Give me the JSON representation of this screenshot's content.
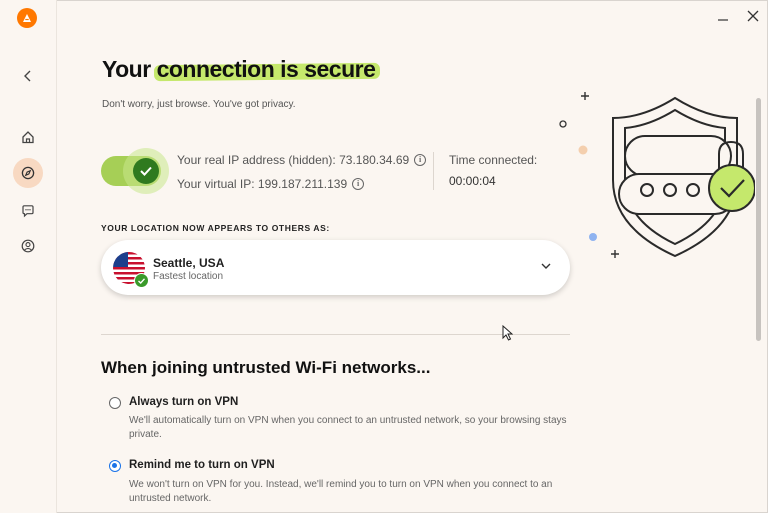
{
  "window": {
    "minimize_icon": "minimize-icon",
    "close_icon": "close-icon"
  },
  "sidebar": {
    "logo": "avast-logo",
    "items": [
      {
        "name": "back",
        "icon": "chevron-left-icon"
      },
      {
        "name": "home",
        "icon": "home-icon"
      },
      {
        "name": "explore",
        "icon": "compass-icon",
        "active": true
      },
      {
        "name": "support",
        "icon": "chat-bubble-icon"
      },
      {
        "name": "account",
        "icon": "user-circle-icon"
      }
    ]
  },
  "header": {
    "title_prefix": "Your",
    "title_highlight": "connection is secure",
    "subtitle": "Don't worry, just browse. You've got privacy."
  },
  "connection": {
    "toggle_on": true,
    "real_ip_label": "Your real IP address (hidden): 73.180.34.69",
    "virtual_ip_label": "Your virtual IP: 199.187.211.139",
    "time_label": "Time connected:",
    "time_value": "00:00:04"
  },
  "location": {
    "section_label": "YOUR LOCATION NOW APPEARS TO OTHERS AS:",
    "city": "Seattle, USA",
    "subtitle": "Fastest location",
    "flag": "us-flag"
  },
  "wifi": {
    "heading": "When joining untrusted Wi-Fi networks...",
    "options": [
      {
        "label": "Always turn on VPN",
        "description": "We'll automatically turn on VPN when you connect to an untrusted network, so your browsing stays private.",
        "selected": false
      },
      {
        "label": "Remind me to turn on VPN",
        "description": "We won't turn on VPN for you. Instead, we'll remind you to turn on VPN when you connect to an untrusted network.",
        "selected": true
      }
    ]
  },
  "colors": {
    "background": "#fbf6f1",
    "accent_green": "#a6cf56",
    "highlight": "#c5e86c",
    "brand_orange": "#ff7800",
    "radio_blue": "#1a73e8"
  }
}
